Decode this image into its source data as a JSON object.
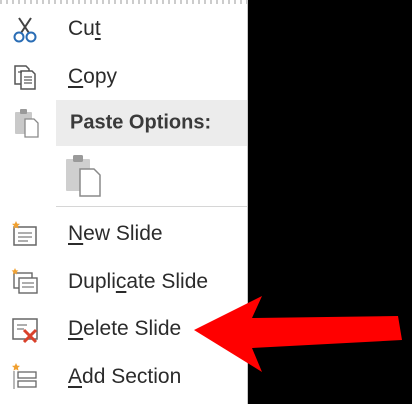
{
  "menu": {
    "cut": {
      "pre": "Cu",
      "acc": "t",
      "post": "",
      "icon": "scissors-icon"
    },
    "copy": {
      "pre": "",
      "acc": "C",
      "post": "opy",
      "icon": "copy-icon"
    },
    "paste_options": {
      "label": "Paste Options:",
      "icon": "clipboard-icon"
    },
    "paste_keep": {
      "icon": "paste-keep-formatting-icon"
    },
    "new_slide": {
      "pre": "",
      "acc": "N",
      "post": "ew Slide",
      "icon": "new-slide-icon"
    },
    "duplicate_slide": {
      "pre": "Dupli",
      "acc": "c",
      "post": "ate Slide",
      "icon": "duplicate-slide-icon"
    },
    "delete_slide": {
      "pre": "",
      "acc": "D",
      "post": "elete Slide",
      "icon": "delete-slide-icon"
    },
    "add_section": {
      "pre": "",
      "acc": "A",
      "post": "dd Section",
      "icon": "add-section-icon"
    }
  },
  "colors": {
    "arrow": "#ff0000",
    "menu_bg": "#ffffff",
    "header_bg": "#ececec",
    "delete_mark": "#d9412b",
    "icon_orange": "#f0a030"
  }
}
